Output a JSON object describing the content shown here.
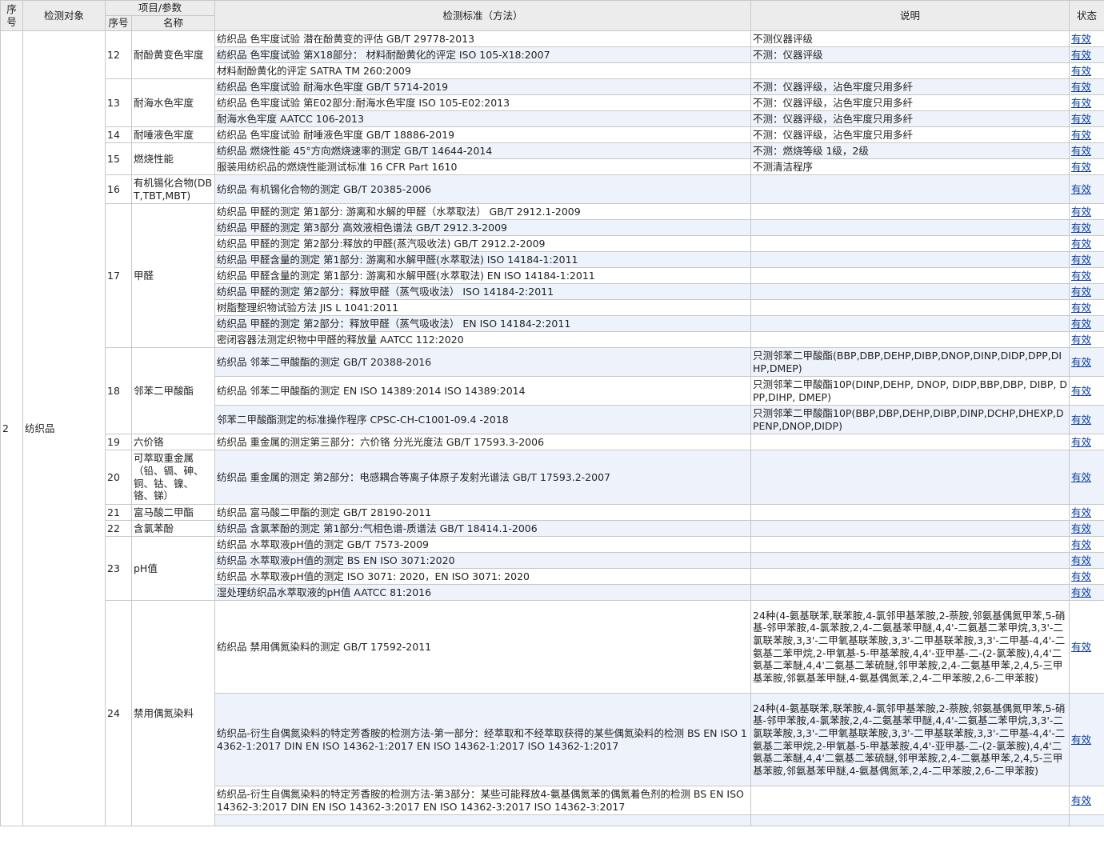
{
  "headers": {
    "seq": "序号",
    "object": "检测对象",
    "item_group": "项目/参数",
    "item_no": "序号",
    "item_name": "名称",
    "standard": "检测标准（方法）",
    "note": "说明",
    "status": "状态"
  },
  "object": {
    "seq": "2",
    "name": "纺织品"
  },
  "status_label": "有效",
  "groups": [
    {
      "no": "12",
      "name": "耐酚黄变色牢度",
      "rows": [
        {
          "std": "纺织品 色牢度试验 潜在酚黄变的评估 GB/T 29778-2013",
          "note": "不测仪器评级"
        },
        {
          "std": "纺织品 色牢度试验 第X18部分： 材料耐酚黄化的评定 ISO 105-X18:2007",
          "note": "不测：仪器评级"
        },
        {
          "std": "材料耐酚黄化的评定 SATRA TM 260:2009",
          "note": ""
        }
      ]
    },
    {
      "no": "13",
      "name": "耐海水色牢度",
      "rows": [
        {
          "std": "纺织品 色牢度试验 耐海水色牢度 GB/T 5714-2019",
          "note": "不测：仪器评级，沾色牢度只用多纤"
        },
        {
          "std": "纺织品 色牢度试验 第E02部分:耐海水色牢度 ISO 105-E02:2013",
          "note": "不测：仪器评级，沾色牢度只用多纤"
        },
        {
          "std": "耐海水色牢度 AATCC 106-2013",
          "note": "不测：仪器评级，沾色牢度只用多纤"
        }
      ]
    },
    {
      "no": "14",
      "name": "耐唾液色牢度",
      "rows": [
        {
          "std": "纺织品 色牢度试验 耐唾液色牢度 GB/T 18886-2019",
          "note": "不测：仪器评级，沾色牢度只用多纤"
        }
      ]
    },
    {
      "no": "15",
      "name": "燃烧性能",
      "rows": [
        {
          "std": "纺织品 燃烧性能 45°方向燃烧速率的测定 GB/T 14644-2014",
          "note": "不测：燃烧等级 1级，2级"
        },
        {
          "std": "服装用纺织品的燃烧性能测试标准 16 CFR Part 1610",
          "note": "不测清洁程序"
        }
      ]
    },
    {
      "no": "16",
      "name": "有机锡化合物(DBT,TBT,MBT)",
      "rows": [
        {
          "std": "纺织品 有机锡化合物的测定 GB/T 20385-2006",
          "note": "",
          "h": 36
        }
      ]
    },
    {
      "no": "17",
      "name": "甲醛",
      "rows": [
        {
          "std": "纺织品 甲醛的测定 第1部分: 游离和水解的甲醛（水萃取法） GB/T 2912.1-2009",
          "note": ""
        },
        {
          "std": "纺织品 甲醛的测定 第3部分 高效液相色谱法 GB/T 2912.3-2009",
          "note": ""
        },
        {
          "std": "纺织品 甲醛的测定 第2部分:释放的甲醛(蒸汽吸收法) GB/T 2912.2-2009",
          "note": ""
        },
        {
          "std": "纺织品 甲醛含量的测定 第1部分: 游离和水解甲醛(水萃取法) ISO 14184-1:2011",
          "note": ""
        },
        {
          "std": "纺织品 甲醛含量的测定 第1部分: 游离和水解甲醛(水萃取法) EN ISO 14184-1:2011",
          "note": ""
        },
        {
          "std": "纺织品 甲醛的测定 第2部分：释放甲醛（蒸气吸收法） ISO 14184-2:2011",
          "note": ""
        },
        {
          "std": "树脂整理织物试验方法 JIS L 1041:2011",
          "note": ""
        },
        {
          "std": "纺织品 甲醛的测定 第2部分：释放甲醛（蒸气吸收法） EN ISO 14184-2:2011",
          "note": ""
        },
        {
          "std": "密闭容器法测定织物中甲醛的释放量 AATCC 112:2020",
          "note": ""
        }
      ]
    },
    {
      "no": "18",
      "name": "邻苯二甲酸酯",
      "rows": [
        {
          "std": "纺织品 邻苯二甲酸酯的测定 GB/T 20388-2016",
          "note": "只测邻苯二甲酸酯(BBP,DBP,DEHP,DIBP,DNOP,DINP,DIDP,DPP,DIHP,DMEP)",
          "h": 36
        },
        {
          "std": "纺织品 邻苯二甲酸酯的测定 EN ISO 14389:2014 ISO 14389:2014",
          "note": "只测邻苯二甲酸酯10P(DINP,DEHP, DNOP, DIDP,BBP,DBP, DIBP, DPP,DIHP, DMEP)",
          "h": 36
        },
        {
          "std": "邻苯二甲酸酯测定的标准操作程序 CPSC-CH-C1001-09.4 -2018",
          "note": "只测邻苯二甲酸酯10P(BBP,DBP,DEHP,DIBP,DINP,DCHP,DHEXP,DPENP,DNOP,DIDP)",
          "h": 36
        }
      ]
    },
    {
      "no": "19",
      "name": "六价铬",
      "rows": [
        {
          "std": "纺织品 重金属的测定第三部分：六价铬 分光光度法 GB/T 17593.3-2006",
          "note": ""
        }
      ]
    },
    {
      "no": "20",
      "name": "可萃取重金属（铅、镉、砷、铜、钴、镍、铬、锑）",
      "rows": [
        {
          "std": "纺织品 重金属的测定 第2部分：电感耦合等离子体原子发射光谱法 GB/T 17593.2-2007",
          "note": "",
          "h": 68
        }
      ]
    },
    {
      "no": "21",
      "name": "富马酸二甲酯",
      "rows": [
        {
          "std": "纺织品 富马酸二甲酯的测定 GB/T 28190-2011",
          "note": ""
        }
      ]
    },
    {
      "no": "22",
      "name": "含氯苯酚",
      "rows": [
        {
          "std": "纺织品 含氯苯酚的测定 第1部分:气相色谱-质谱法 GB/T 18414.1-2006",
          "note": ""
        }
      ]
    },
    {
      "no": "23",
      "name": "pH值",
      "rows": [
        {
          "std": "纺织品 水萃取液pH值的测定 GB/T 7573-2009",
          "note": ""
        },
        {
          "std": "纺织品 水萃取液pH值的测定 BS EN ISO 3071:2020",
          "note": ""
        },
        {
          "std": "纺织品 水萃取液pH值的测定 ISO 3071: 2020，EN ISO 3071: 2020",
          "note": ""
        },
        {
          "std": "湿处理纺织品水萃取液的pH值 AATCC 81:2016",
          "note": ""
        }
      ]
    },
    {
      "no": "24",
      "name": "禁用偶氮染料",
      "rows": [
        {
          "std": "纺织品 禁用偶氮染料的测定 GB/T 17592-2011",
          "note": "24种(4-氨基联苯,联苯胺,4-氯邻甲基苯胺,2-萘胺,邻氨基偶氮甲苯,5-硝基-邻甲苯胺,4-氯苯胺,2,4-二氨基苯甲醚,4,4'-二氨基二苯甲烷,3,3'-二氯联苯胺,3,3'-二甲氧基联苯胺,3,3'-二甲基联苯胺,3,3'-二甲基-4,4'-二氨基二苯甲烷,2-甲氧基-5-甲基苯胺,4,4'-亚甲基-二-(2-氯苯胺),4,4'二氨基二苯醚,4,4'二氨基二苯硫醚,邻甲苯胺,2,4-二氨基甲苯,2,4,5-三甲基苯胺,邻氨基苯甲醚,4-氨基偶氮苯,2,4-二甲苯胺,2,6-二甲苯胺)",
          "h": 116
        },
        {
          "std": "纺织品-衍生自偶氮染料的特定芳香胺的检测方法-第一部分：经萃取和不经萃取获得的某些偶氮染料的检测 BS EN ISO 14362-1:2017 DIN EN ISO 14362-1:2017 EN ISO 14362-1:2017 ISO 14362-1:2017",
          "note": "24种(4-氨基联苯,联苯胺,4-氯邻甲基苯胺,2-萘胺,邻氨基偶氮甲苯,5-硝基-邻甲苯胺,4-氯苯胺,2,4-二氨基苯甲醚,4,4'-二氨基二苯甲烷,3,3'-二氯联苯胺,3,3'-二甲氧基联苯胺,3,3'-二甲基联苯胺,3,3'-二甲基-4,4'-二氨基二苯甲烷,2-甲氧基-5-甲基苯胺,4,4'-亚甲基-二-(2-氯苯胺),4,4'二氨基二苯醚,4,4'二氨基二苯硫醚,邻甲苯胺,2,4-二氨基甲苯,2,4,5-三甲基苯胺,邻氨基苯甲醚,4-氨基偶氮苯,2,4-二甲苯胺,2,6-二甲苯胺)",
          "h": 116
        },
        {
          "std": "纺织品-衍生自偶氮染料的特定芳香胺的检测方法-第3部分：某些可能释放4-氨基偶氮苯的偶氮着色剂的检测 BS EN ISO 14362-3:2017 DIN EN ISO 14362-3:2017 EN ISO 14362-3:2017 ISO 14362-3:2017",
          "note": "",
          "h": 36
        },
        {
          "std": "",
          "note": "",
          "h": 14
        }
      ]
    }
  ]
}
